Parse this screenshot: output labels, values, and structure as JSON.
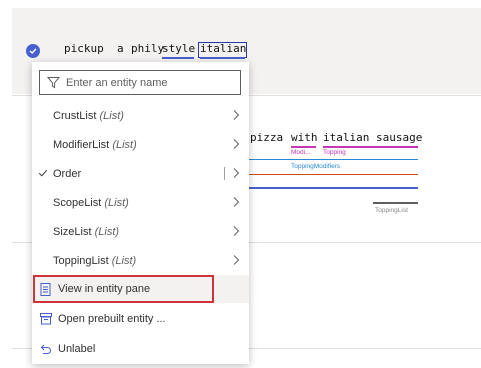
{
  "utterance": {
    "words": [
      "pickup",
      "a",
      "phily",
      "style",
      "italian"
    ],
    "selected_word": "italian"
  },
  "second_utterance": {
    "words": [
      "pizza",
      "with",
      "italian",
      "sausage"
    ],
    "labels": {
      "modifier_short": "Modi...",
      "topping": "Topping",
      "topping_modifiers": "ToppingModifiers",
      "topping_list": "ToppingList"
    }
  },
  "colors": {
    "accent": "#4a5fcf",
    "modifier": "#c239b3",
    "topping": "#2b88d8",
    "order": "#ca5010",
    "highlight": "#d13438"
  },
  "menu": {
    "filter_placeholder": "Enter an entity name",
    "entities": [
      {
        "name": "CrustList",
        "tag": "(List)",
        "checked": false
      },
      {
        "name": "ModifierList",
        "tag": "(List)",
        "checked": false
      },
      {
        "name": "Order",
        "tag": "",
        "checked": true
      },
      {
        "name": "ScopeList",
        "tag": "(List)",
        "checked": false
      },
      {
        "name": "SizeList",
        "tag": "(List)",
        "checked": false
      },
      {
        "name": "ToppingList",
        "tag": "(List)",
        "checked": false
      }
    ],
    "actions": {
      "view_in_entity_pane": "View in entity pane",
      "open_prebuilt_entity": "Open prebuilt entity ...",
      "unlabel": "Unlabel"
    }
  }
}
